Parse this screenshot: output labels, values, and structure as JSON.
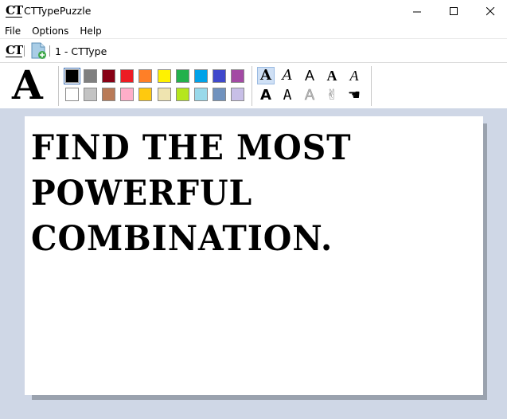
{
  "window": {
    "title": "CTTypePuzzle",
    "app_icon": "CT"
  },
  "window_controls": [
    "minimize",
    "maximize",
    "close"
  ],
  "menu": {
    "items": [
      "File",
      "Options",
      "Help"
    ]
  },
  "docbar": {
    "logo": "CT",
    "tab_label": "1 - CTType"
  },
  "toolbar": {
    "big_letter": "A",
    "colors_row1": [
      "#000000",
      "#7f7f7f",
      "#880015",
      "#ed1c24",
      "#ff7f27",
      "#fff200",
      "#22b14c",
      "#00a2e8",
      "#3f48cc",
      "#a349a4"
    ],
    "colors_row2": [
      "#ffffff",
      "#c3c3c3",
      "#b97a57",
      "#ffaec9",
      "#ffc90e",
      "#efe4b0",
      "#b5e61d",
      "#99d9ea",
      "#7092be",
      "#c8bfe7"
    ],
    "selected_color": "#000000",
    "fonts_row1": [
      "A",
      "A",
      "A",
      "A",
      "A"
    ],
    "fonts_row2": [
      "A",
      "A",
      "A",
      "✌",
      "☚"
    ]
  },
  "puzzle": {
    "lines": [
      "FIND THE MOST",
      "POWERFUL",
      "COMBINATION."
    ]
  }
}
